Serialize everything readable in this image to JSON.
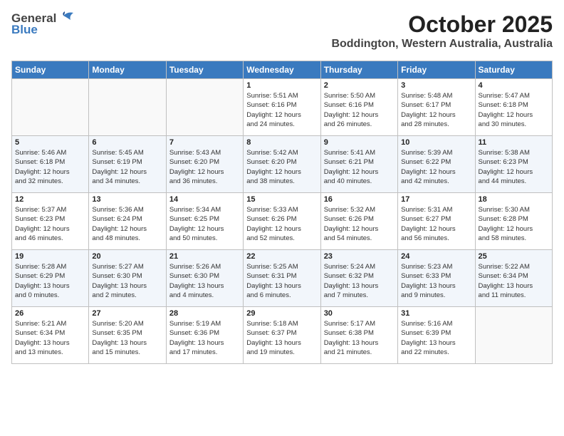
{
  "header": {
    "logo_general": "General",
    "logo_blue": "Blue",
    "month_title": "October 2025",
    "location": "Boddington, Western Australia, Australia"
  },
  "weekdays": [
    "Sunday",
    "Monday",
    "Tuesday",
    "Wednesday",
    "Thursday",
    "Friday",
    "Saturday"
  ],
  "weeks": [
    [
      {
        "day": "",
        "info": ""
      },
      {
        "day": "",
        "info": ""
      },
      {
        "day": "",
        "info": ""
      },
      {
        "day": "1",
        "info": "Sunrise: 5:51 AM\nSunset: 6:16 PM\nDaylight: 12 hours\nand 24 minutes."
      },
      {
        "day": "2",
        "info": "Sunrise: 5:50 AM\nSunset: 6:16 PM\nDaylight: 12 hours\nand 26 minutes."
      },
      {
        "day": "3",
        "info": "Sunrise: 5:48 AM\nSunset: 6:17 PM\nDaylight: 12 hours\nand 28 minutes."
      },
      {
        "day": "4",
        "info": "Sunrise: 5:47 AM\nSunset: 6:18 PM\nDaylight: 12 hours\nand 30 minutes."
      }
    ],
    [
      {
        "day": "5",
        "info": "Sunrise: 5:46 AM\nSunset: 6:18 PM\nDaylight: 12 hours\nand 32 minutes."
      },
      {
        "day": "6",
        "info": "Sunrise: 5:45 AM\nSunset: 6:19 PM\nDaylight: 12 hours\nand 34 minutes."
      },
      {
        "day": "7",
        "info": "Sunrise: 5:43 AM\nSunset: 6:20 PM\nDaylight: 12 hours\nand 36 minutes."
      },
      {
        "day": "8",
        "info": "Sunrise: 5:42 AM\nSunset: 6:20 PM\nDaylight: 12 hours\nand 38 minutes."
      },
      {
        "day": "9",
        "info": "Sunrise: 5:41 AM\nSunset: 6:21 PM\nDaylight: 12 hours\nand 40 minutes."
      },
      {
        "day": "10",
        "info": "Sunrise: 5:39 AM\nSunset: 6:22 PM\nDaylight: 12 hours\nand 42 minutes."
      },
      {
        "day": "11",
        "info": "Sunrise: 5:38 AM\nSunset: 6:23 PM\nDaylight: 12 hours\nand 44 minutes."
      }
    ],
    [
      {
        "day": "12",
        "info": "Sunrise: 5:37 AM\nSunset: 6:23 PM\nDaylight: 12 hours\nand 46 minutes."
      },
      {
        "day": "13",
        "info": "Sunrise: 5:36 AM\nSunset: 6:24 PM\nDaylight: 12 hours\nand 48 minutes."
      },
      {
        "day": "14",
        "info": "Sunrise: 5:34 AM\nSunset: 6:25 PM\nDaylight: 12 hours\nand 50 minutes."
      },
      {
        "day": "15",
        "info": "Sunrise: 5:33 AM\nSunset: 6:26 PM\nDaylight: 12 hours\nand 52 minutes."
      },
      {
        "day": "16",
        "info": "Sunrise: 5:32 AM\nSunset: 6:26 PM\nDaylight: 12 hours\nand 54 minutes."
      },
      {
        "day": "17",
        "info": "Sunrise: 5:31 AM\nSunset: 6:27 PM\nDaylight: 12 hours\nand 56 minutes."
      },
      {
        "day": "18",
        "info": "Sunrise: 5:30 AM\nSunset: 6:28 PM\nDaylight: 12 hours\nand 58 minutes."
      }
    ],
    [
      {
        "day": "19",
        "info": "Sunrise: 5:28 AM\nSunset: 6:29 PM\nDaylight: 13 hours\nand 0 minutes."
      },
      {
        "day": "20",
        "info": "Sunrise: 5:27 AM\nSunset: 6:30 PM\nDaylight: 13 hours\nand 2 minutes."
      },
      {
        "day": "21",
        "info": "Sunrise: 5:26 AM\nSunset: 6:30 PM\nDaylight: 13 hours\nand 4 minutes."
      },
      {
        "day": "22",
        "info": "Sunrise: 5:25 AM\nSunset: 6:31 PM\nDaylight: 13 hours\nand 6 minutes."
      },
      {
        "day": "23",
        "info": "Sunrise: 5:24 AM\nSunset: 6:32 PM\nDaylight: 13 hours\nand 7 minutes."
      },
      {
        "day": "24",
        "info": "Sunrise: 5:23 AM\nSunset: 6:33 PM\nDaylight: 13 hours\nand 9 minutes."
      },
      {
        "day": "25",
        "info": "Sunrise: 5:22 AM\nSunset: 6:34 PM\nDaylight: 13 hours\nand 11 minutes."
      }
    ],
    [
      {
        "day": "26",
        "info": "Sunrise: 5:21 AM\nSunset: 6:34 PM\nDaylight: 13 hours\nand 13 minutes."
      },
      {
        "day": "27",
        "info": "Sunrise: 5:20 AM\nSunset: 6:35 PM\nDaylight: 13 hours\nand 15 minutes."
      },
      {
        "day": "28",
        "info": "Sunrise: 5:19 AM\nSunset: 6:36 PM\nDaylight: 13 hours\nand 17 minutes."
      },
      {
        "day": "29",
        "info": "Sunrise: 5:18 AM\nSunset: 6:37 PM\nDaylight: 13 hours\nand 19 minutes."
      },
      {
        "day": "30",
        "info": "Sunrise: 5:17 AM\nSunset: 6:38 PM\nDaylight: 13 hours\nand 21 minutes."
      },
      {
        "day": "31",
        "info": "Sunrise: 5:16 AM\nSunset: 6:39 PM\nDaylight: 13 hours\nand 22 minutes."
      },
      {
        "day": "",
        "info": ""
      }
    ]
  ]
}
